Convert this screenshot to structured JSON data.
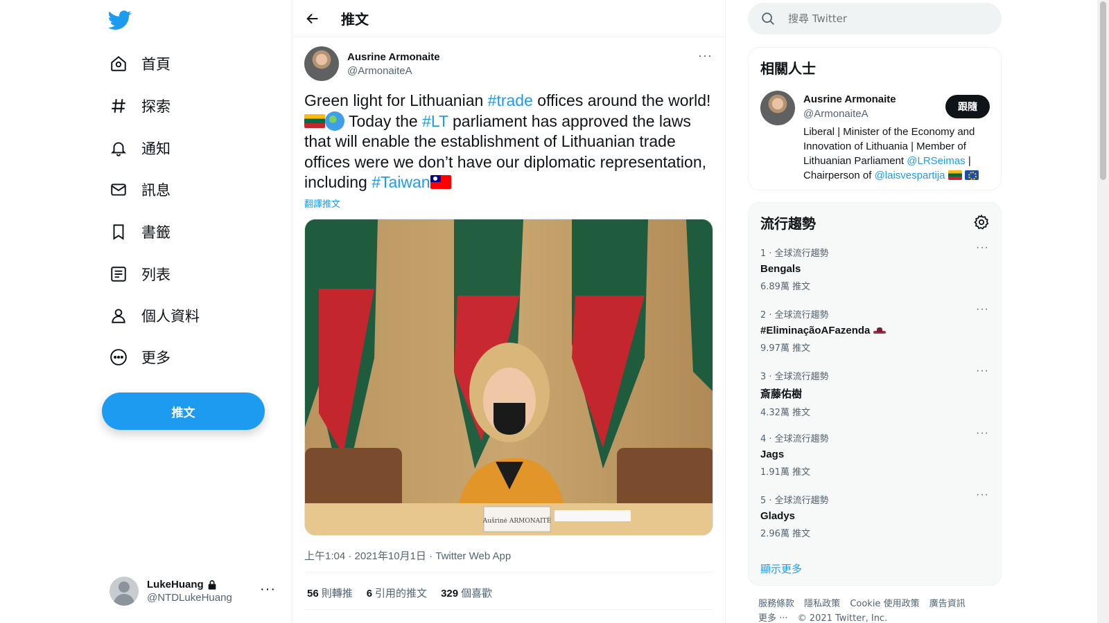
{
  "nav": {
    "items": [
      {
        "label": "首頁",
        "icon": "home-icon"
      },
      {
        "label": "探索",
        "icon": "hashtag-icon"
      },
      {
        "label": "通知",
        "icon": "bell-icon"
      },
      {
        "label": "訊息",
        "icon": "mail-icon"
      },
      {
        "label": "書籤",
        "icon": "bookmark-icon"
      },
      {
        "label": "列表",
        "icon": "list-icon"
      },
      {
        "label": "個人資料",
        "icon": "profile-icon"
      },
      {
        "label": "更多",
        "icon": "more-circle-icon"
      }
    ],
    "tweet_button": "推文"
  },
  "account": {
    "name": "LukeHuang",
    "handle": "@NTDLukeHuang",
    "more": "···"
  },
  "main": {
    "title": "推文",
    "tweet": {
      "author_name": "Ausrine Armonaite",
      "author_handle": "@ArmonaiteA",
      "text": {
        "p1": "Green light for Lithuanian ",
        "h1": "#trade",
        "p2": " offices around the world!",
        "p3": " Today the ",
        "h2": "#LT",
        "p4": " parliament has approved the laws that will enable the establishment of Lithuanian trade offices were we don’t have our diplomatic representation, including ",
        "h3": "#Taiwan"
      },
      "translate": "翻譯推文",
      "nameplate": "Aušrinė ARMONAITĖ",
      "meta": "上午1:04 · 2021年10月1日 · Twitter Web App",
      "stats": [
        {
          "count": "56",
          "label": "則轉推"
        },
        {
          "count": "6",
          "label": "引用的推文"
        },
        {
          "count": "329",
          "label": "個喜歡"
        }
      ]
    }
  },
  "search": {
    "placeholder": "搜尋 Twitter"
  },
  "who": {
    "title": "相關人士",
    "name": "Ausrine Armonaite",
    "handle": "@ArmonaiteA",
    "follow": "跟隨",
    "bio_1": "Liberal | Minister of the Economy and Innovation of Lithuania | Member of Lithuanian Parliament ",
    "bio_link1": "@LRSeimas",
    "bio_2": " | Chairperson of ",
    "bio_link2": "@laisvespartija"
  },
  "trends": {
    "title": "流行趨勢",
    "items": [
      {
        "context": "1 · 全球流行趨勢",
        "name": "Bengals",
        "count": "6.89萬 推文"
      },
      {
        "context": "2 · 全球流行趨勢",
        "name": "#EliminaçãoAFazenda",
        "count": "9.97萬 推文"
      },
      {
        "context": "3 · 全球流行趨勢",
        "name": "斎藤佑樹",
        "count": "4.32萬 推文"
      },
      {
        "context": "4 · 全球流行趨勢",
        "name": "Jags",
        "count": "1.91萬 推文"
      },
      {
        "context": "5 · 全球流行趨勢",
        "name": "Gladys",
        "count": "2.96萬 推文"
      }
    ],
    "more": "···",
    "show_more": "顯示更多"
  },
  "footer": {
    "links": [
      "服務條款",
      "隱私政策",
      "Cookie 使用政策",
      "廣告資訊"
    ],
    "more": "更多 ···",
    "copyright": "© 2021 Twitter, Inc."
  },
  "colors": {
    "accent": "#1d9bf0",
    "text": "#0f1419",
    "muted": "#536471"
  }
}
